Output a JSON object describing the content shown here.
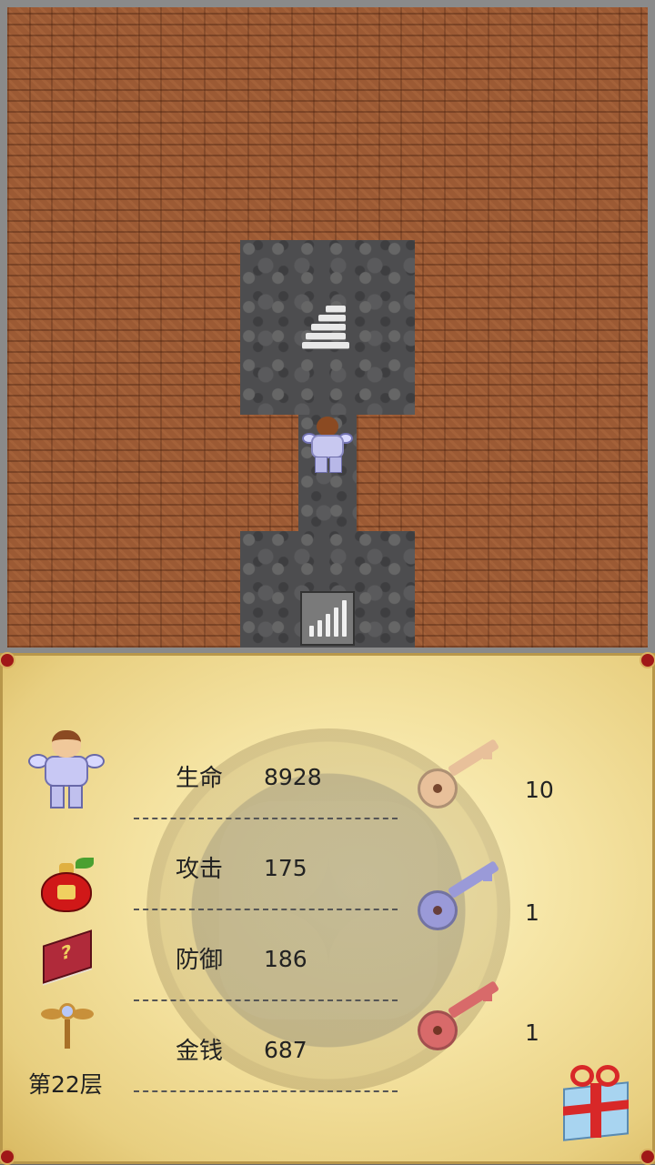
{
  "map": {
    "tiles": {
      "stairs_up": "stairs-up-icon",
      "stairs_down": "stairs-down-icon",
      "hero": "hero-sprite"
    },
    "colors": {
      "wall": "#9c5a34",
      "floor": "#4d4d4f"
    }
  },
  "panel": {
    "stats": [
      {
        "label": "生命",
        "value": "8928"
      },
      {
        "label": "攻击",
        "value": "175"
      },
      {
        "label": "防御",
        "value": "186"
      },
      {
        "label": "金钱",
        "value": "687"
      }
    ],
    "floor_label": "第22层",
    "keys": [
      {
        "name": "yellow-key-icon",
        "count": "10",
        "color": "#e8c09a"
      },
      {
        "name": "blue-key-icon",
        "count": "1",
        "color": "#9a9ad8"
      },
      {
        "name": "red-key-icon",
        "count": "1",
        "color": "#d86a6a"
      }
    ],
    "items": [
      "hero-portrait-icon",
      "lucky-bag-icon",
      "monster-manual-icon",
      "flight-staff-icon",
      "gift-box-icon"
    ]
  }
}
